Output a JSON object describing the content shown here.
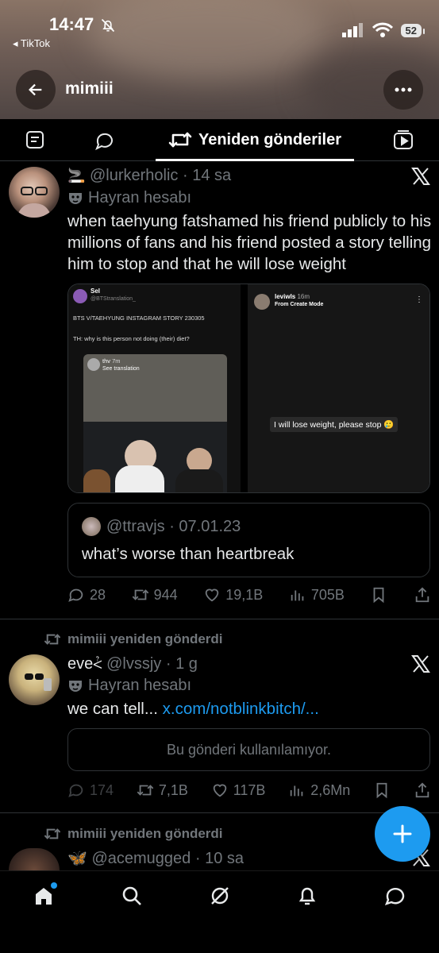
{
  "status_bar": {
    "time": "14:47",
    "back_app": "◂ TikTok",
    "battery": "52"
  },
  "nav": {
    "title": "mimiii"
  },
  "tabs": {
    "active_label": "Yeniden gönderiler"
  },
  "tweet1": {
    "handle": "@lurkerholic",
    "time": "· 14 sa",
    "fan_label": "Hayran hesabı",
    "text": "when taehyung fatshamed his friend publicly to his millions of fans and his friend posted a story telling him to stop and that he will lose weight",
    "media_left": {
      "name": "Sel",
      "handle": "@BTStranslation_",
      "line1": "BTS V/TAEHYUNG INSTAGRAM STORY 230305",
      "line2": "TH: why is this person not doing (their) diet?",
      "story_user": "thv",
      "story_time": "7m",
      "story_sub": "See translation"
    },
    "media_right": {
      "user": "leviwls",
      "time": "16m",
      "sub": "From Create Mode",
      "caption": "I will lose weight, please stop 🥲"
    },
    "quote": {
      "handle": "@ttravjs",
      "date": "· 07.01.23",
      "text": "what’s worse than heartbreak"
    },
    "stats": {
      "replies": "28",
      "reposts": "944",
      "likes": "19,1B",
      "views": "705B"
    }
  },
  "tweet2": {
    "repost_label": "mimiii yeniden gönderdi",
    "display_name": "eve⩻",
    "handle": "@lvssjy",
    "time": "· 1 g",
    "fan_label": "Hayran hesabı",
    "text": "we can tell...",
    "link": "x.com/notblinkbitch/...",
    "unavailable": "Bu gönderi kullanılamıyor.",
    "stats": {
      "replies": "174",
      "reposts": "7,1B",
      "likes": "117B",
      "views": "2,6Mn"
    }
  },
  "tweet3": {
    "repost_label": "mimiii yeniden gönderdi",
    "emoji": "🦋",
    "handle": "@acemugged",
    "time": "· 10 sa"
  },
  "colors": {
    "accent": "#1d9bf0",
    "muted": "#71767b",
    "text": "#e7e9ea",
    "divider": "#2f3336"
  }
}
